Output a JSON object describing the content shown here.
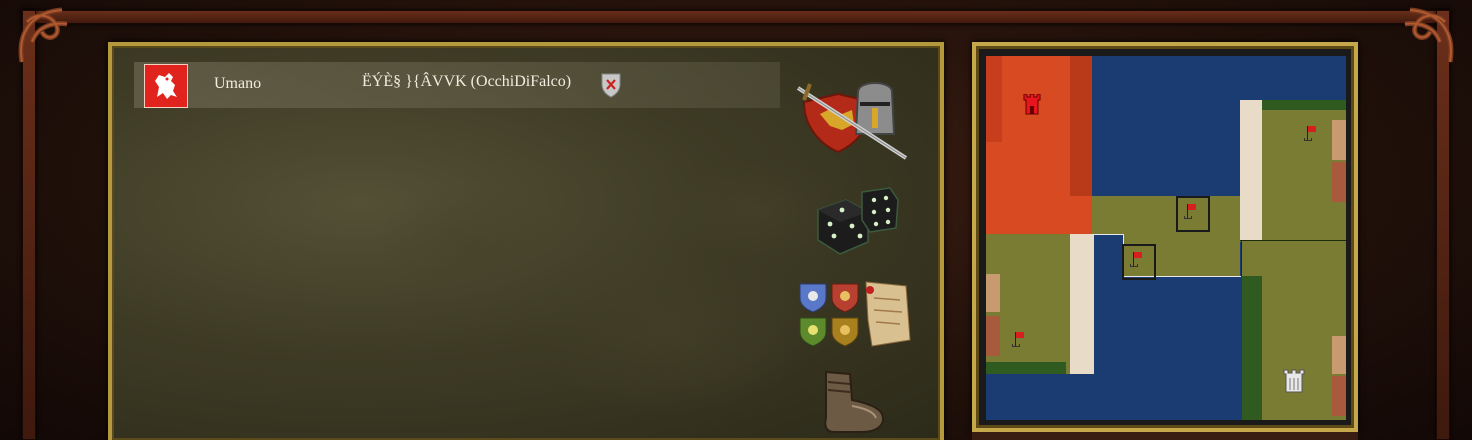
{
  "player": {
    "race": "Umano",
    "name": "ËÝÈ§ }{ÂVVK (OcchiDiFalco)"
  },
  "icons": {
    "faction_banner": "red-lion-banner-icon",
    "team_shield": "grey-shield-red-x-icon",
    "combat": "sword-helmet-shield-icon",
    "random": "dice-icon",
    "factions": "faction-shields-scroll-icon",
    "leave": "boot-icon"
  },
  "map": {
    "colors": {
      "ocean": "#1a3c73",
      "grass": "#7a7c34",
      "red_territory": "#d84a22",
      "sand": "#e8dcc8",
      "dark_grass": "#2f5a20",
      "border": "#c4a84a"
    },
    "markers": [
      "red-castle-icon",
      "red-flag-icon",
      "white-castle-icon"
    ]
  }
}
